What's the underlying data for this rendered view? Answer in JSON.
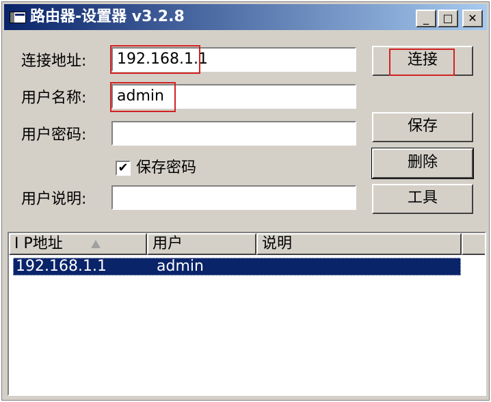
{
  "window": {
    "title": "路由器-设置器 v3.2.8",
    "controls": {
      "minimize": "_",
      "maximize": "□",
      "close": "✕"
    }
  },
  "form": {
    "address_label": "连接地址:",
    "address_value": "192.168.1.1",
    "username_label": "用户名称:",
    "username_value": "admin",
    "password_label": "用户密码:",
    "password_value": "",
    "save_password_label": "保存密码",
    "save_password_checked": true,
    "check_mark": "✔",
    "description_label": "用户说明:",
    "description_value": ""
  },
  "buttons": {
    "connect": "连接",
    "save": "保存",
    "delete": "删除",
    "tools": "工具"
  },
  "list": {
    "columns": [
      "I P地址",
      "用户",
      "说明"
    ],
    "sort_column": "I P地址",
    "rows": [
      {
        "ip": "192.168.1.1",
        "user": "admin",
        "note": ""
      }
    ]
  },
  "colors": {
    "titlebar_start": "#0a246a",
    "titlebar_end": "#a6caf0",
    "window_face": "#d4d0c8",
    "selection": "#0a246a",
    "annotation_red": "#d22020"
  },
  "icons": {
    "app": "window-app-icon",
    "sort": "sort-ascending-icon",
    "check": "checkmark-icon"
  }
}
